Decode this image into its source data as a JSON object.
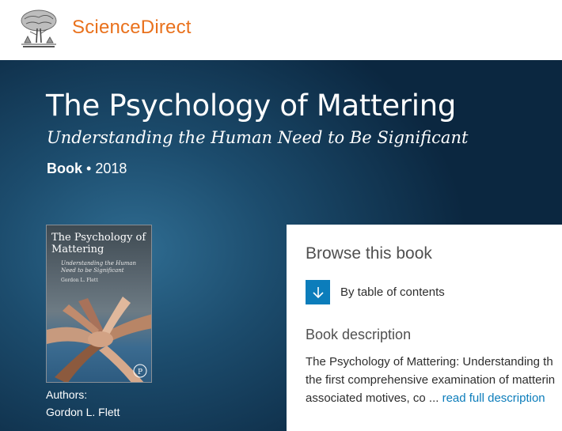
{
  "header": {
    "brand_label": "ScienceDirect",
    "logo_icon": "elsevier-tree-logo-icon",
    "brand_color": "#e9711c"
  },
  "book": {
    "title": "The Psychology of Mattering",
    "subtitle": "Understanding the Human Need to Be Significant",
    "type": "Book",
    "separator": "•",
    "year": "2018",
    "cover": {
      "title": "The Psychology of Mattering",
      "subtitle": "Understanding the Human Need to be Significant",
      "author": "Gordon L. Flett"
    },
    "authors_label": "Authors:",
    "author": "Gordon L. Flett"
  },
  "browse": {
    "title": "Browse this book",
    "toc_icon": "arrow-down-icon",
    "toc_label": "By table of contents",
    "accent_color": "#0c7dbb"
  },
  "description": {
    "title": "Book description",
    "lines": [
      "The Psychology of Mattering: Understanding th",
      "the first comprehensive examination of matterin",
      "associated motives, co ..."
    ],
    "read_more_label": "read full description"
  }
}
